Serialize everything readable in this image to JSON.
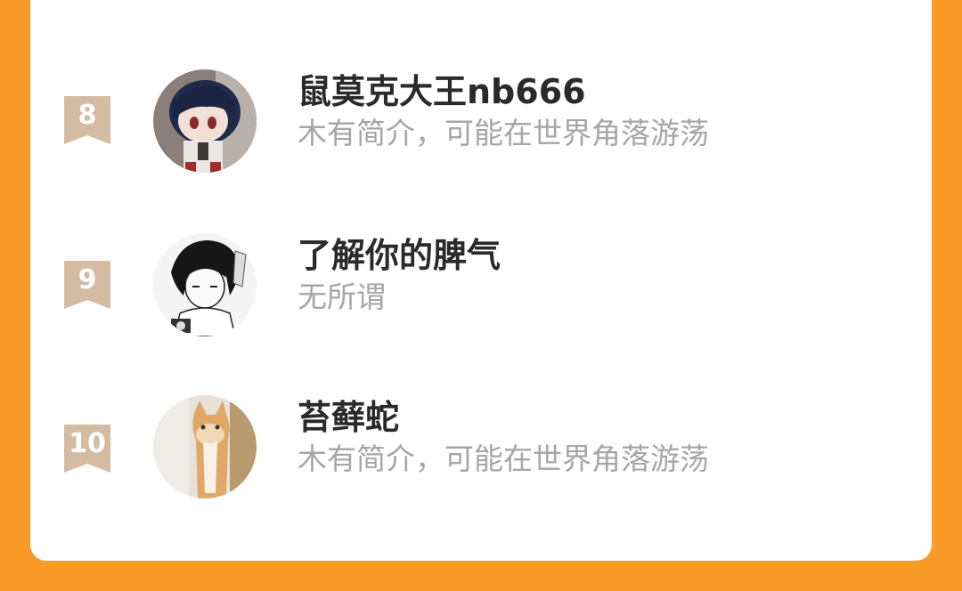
{
  "leaderboard": {
    "entries": [
      {
        "rank": "8",
        "name": "鼠莫克大王nb666",
        "bio": "木有简介，可能在世界角落游荡",
        "avatar_icon": "anime-plush-avatar-icon"
      },
      {
        "rank": "9",
        "name": "了解你的脾气",
        "bio": "无所谓",
        "avatar_icon": "manga-boy-avatar-icon"
      },
      {
        "rank": "10",
        "name": "苔藓蛇",
        "bio": "木有简介，可能在世界角落游荡",
        "avatar_icon": "cat-avatar-icon"
      }
    ]
  },
  "colors": {
    "background": "#fb9b27",
    "card": "#ffffff",
    "rank_badge": "#d6bba3",
    "name_text": "#2a2a2a",
    "bio_text": "#a6a6a6"
  }
}
